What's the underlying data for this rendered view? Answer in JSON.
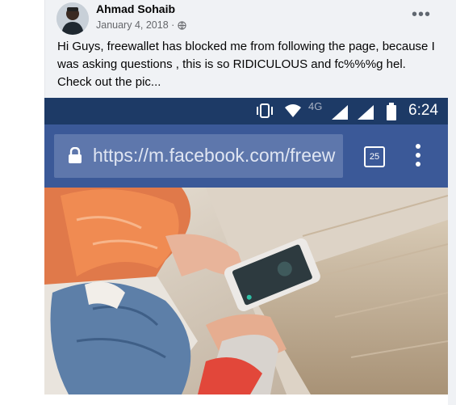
{
  "post": {
    "author": "Ahmad Sohaib",
    "date": "January 4, 2018 ·",
    "more_label": "•••",
    "text": "Hi Guys, freewallet has blocked me from following the page, because I was asking questions , this is so RIDICULOUS and fc%%%g hel. Check out the pic..."
  },
  "phone": {
    "network": "4G",
    "time": "6:24",
    "url": "https://m.facebook.com/freew",
    "tab_count": "25"
  },
  "colors": {
    "status_bar": "#1d3a66",
    "url_bar": "#3b5998",
    "text": "#050505",
    "meta": "#65676b"
  }
}
